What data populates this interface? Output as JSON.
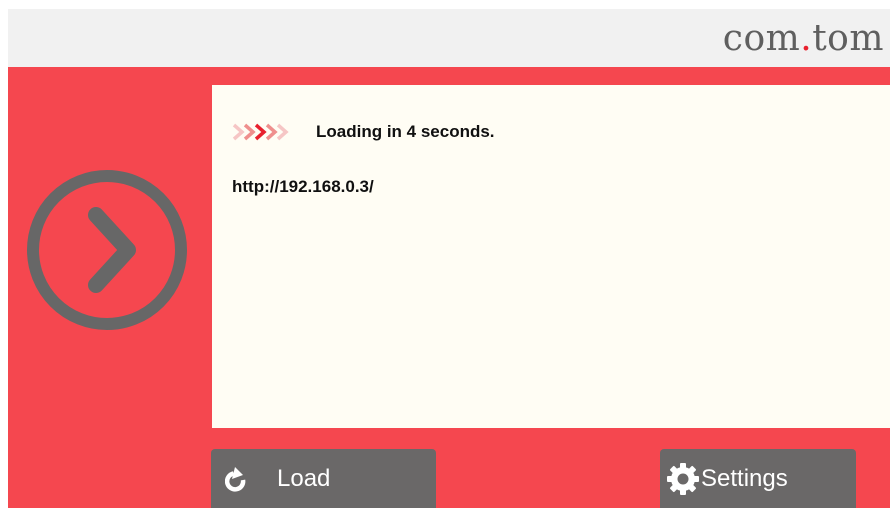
{
  "header": {
    "brand_prefix": "com",
    "brand_dot": ".",
    "brand_suffix": "tom"
  },
  "status": {
    "message": "Loading in 4 seconds.",
    "url": "http://192.168.0.3/"
  },
  "buttons": {
    "load_label": "Load",
    "settings_label": "Settings"
  },
  "icons": {
    "go": "chevron-right-circle-icon",
    "progress": "loading-arrows-icon",
    "load": "refresh-icon",
    "settings": "gear-icon"
  },
  "colors": {
    "background": "#f5474f",
    "panel": "#fffdf4",
    "header": "#f1f1f1",
    "button": "#6a6868",
    "brand_dot": "#e8202d",
    "icon_gray": "#676767"
  }
}
